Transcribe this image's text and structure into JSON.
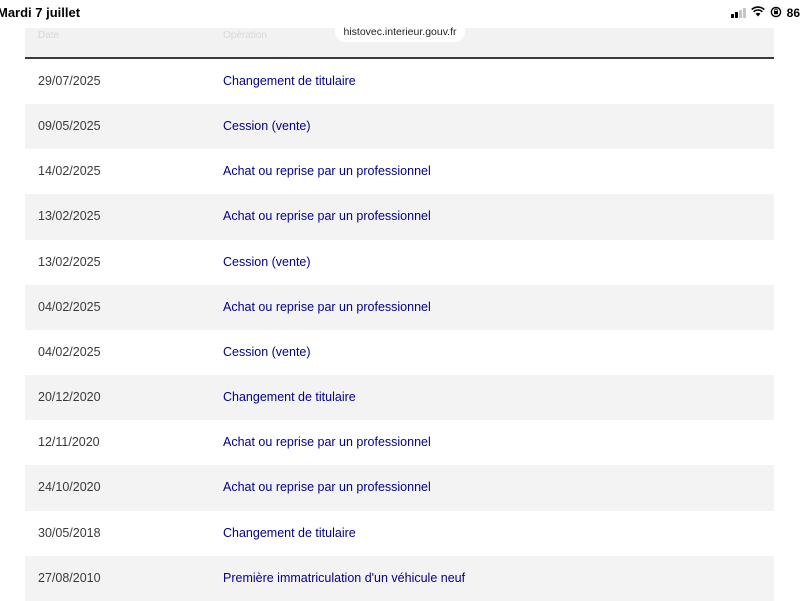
{
  "status_bar": {
    "time": "Mardi 7 juillet",
    "battery": "86"
  },
  "browser": {
    "url": "histovec.interieur.gouv.fr"
  },
  "table": {
    "columns": [
      "Date",
      "Opération"
    ],
    "rows": [
      {
        "date": "29/07/2025",
        "operation": "Changement de titulaire"
      },
      {
        "date": "09/05/2025",
        "operation": "Cession (vente)"
      },
      {
        "date": "14/02/2025",
        "operation": "Achat ou reprise par un professionnel"
      },
      {
        "date": "13/02/2025",
        "operation": "Achat ou reprise par un professionnel"
      },
      {
        "date": "13/02/2025",
        "operation": "Cession (vente)"
      },
      {
        "date": "04/02/2025",
        "operation": "Achat ou reprise par un professionnel"
      },
      {
        "date": "04/02/2025",
        "operation": "Cession (vente)"
      },
      {
        "date": "20/12/2020",
        "operation": "Changement de titulaire"
      },
      {
        "date": "12/11/2020",
        "operation": "Achat ou reprise par un professionnel"
      },
      {
        "date": "24/10/2020",
        "operation": "Achat ou reprise par un professionnel"
      },
      {
        "date": "30/05/2018",
        "operation": "Changement de titulaire"
      },
      {
        "date": "27/08/2010",
        "operation": "Première immatriculation d'un véhicule neuf"
      }
    ]
  }
}
